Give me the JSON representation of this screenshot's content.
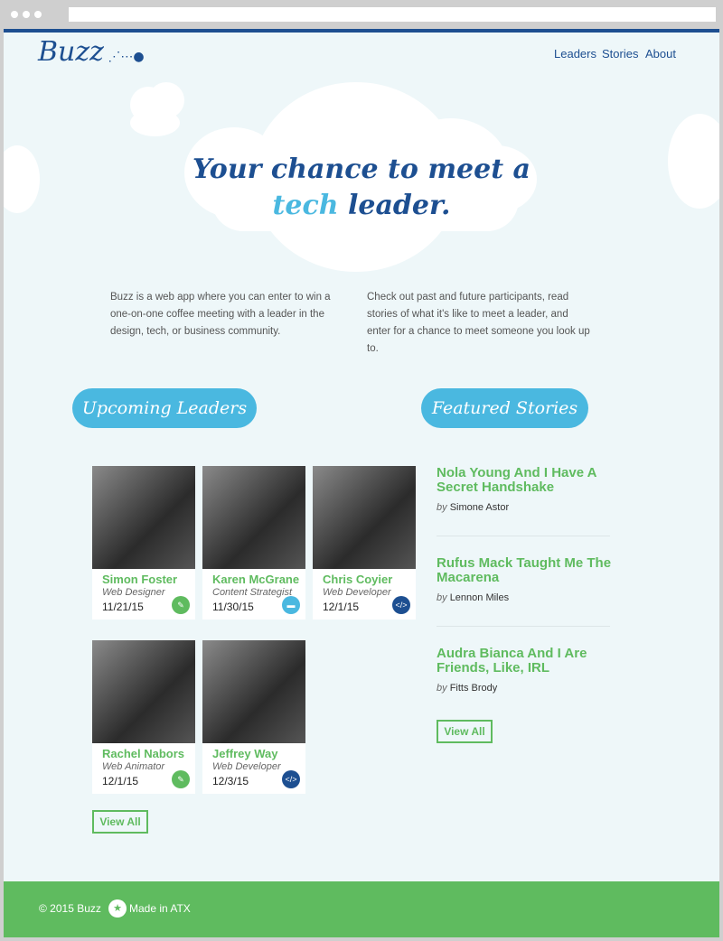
{
  "header": {
    "logo": "Buzz",
    "nav": [
      "Leaders",
      "Stories",
      "About"
    ]
  },
  "hero": {
    "line1": "Your chance to meet a",
    "highlight": "tech",
    "line2_rest": " leader."
  },
  "intro": {
    "left": "Buzz is a web app where you can enter to win a one-on-one coffee meeting with a leader in the design, tech, or business community.",
    "right": "Check out past and future participants, read stories of what it's like to meet a leader, and enter for a chance to meet someone you look up to."
  },
  "leaders": {
    "heading": "Upcoming Leaders",
    "view_all": "View All",
    "items": [
      {
        "name": "Simon Foster",
        "role": "Web Designer",
        "date": "11/21/15",
        "icon": "pencil-icon",
        "color": "#5fbb5f"
      },
      {
        "name": "Karen McGrane",
        "role": "Content Strategist",
        "date": "11/30/15",
        "icon": "briefcase-icon",
        "color": "#4ab8e0"
      },
      {
        "name": "Chris Coyier",
        "role": "Web Developer",
        "date": "12/1/15",
        "icon": "code-icon",
        "color": "#1d4f91"
      },
      {
        "name": "Rachel Nabors",
        "role": "Web Animator",
        "date": "12/1/15",
        "icon": "pencil-icon",
        "color": "#5fbb5f"
      },
      {
        "name": "Jeffrey Way",
        "role": "Web Developer",
        "date": "12/3/15",
        "icon": "code-icon",
        "color": "#1d4f91"
      }
    ]
  },
  "stories": {
    "heading": "Featured Stories",
    "view_all": "View All",
    "by": "by",
    "items": [
      {
        "title": "Nola Young And I Have A Secret Handshake",
        "author": "Simone Astor"
      },
      {
        "title": "Rufus Mack Taught Me The Macarena",
        "author": "Lennon Miles"
      },
      {
        "title": "Audra Bianca And I Are Friends, Like, IRL",
        "author": "Fitts Brody"
      }
    ]
  },
  "footer": {
    "copyright": "© 2015 Buzz",
    "made": "Made in ATX"
  }
}
